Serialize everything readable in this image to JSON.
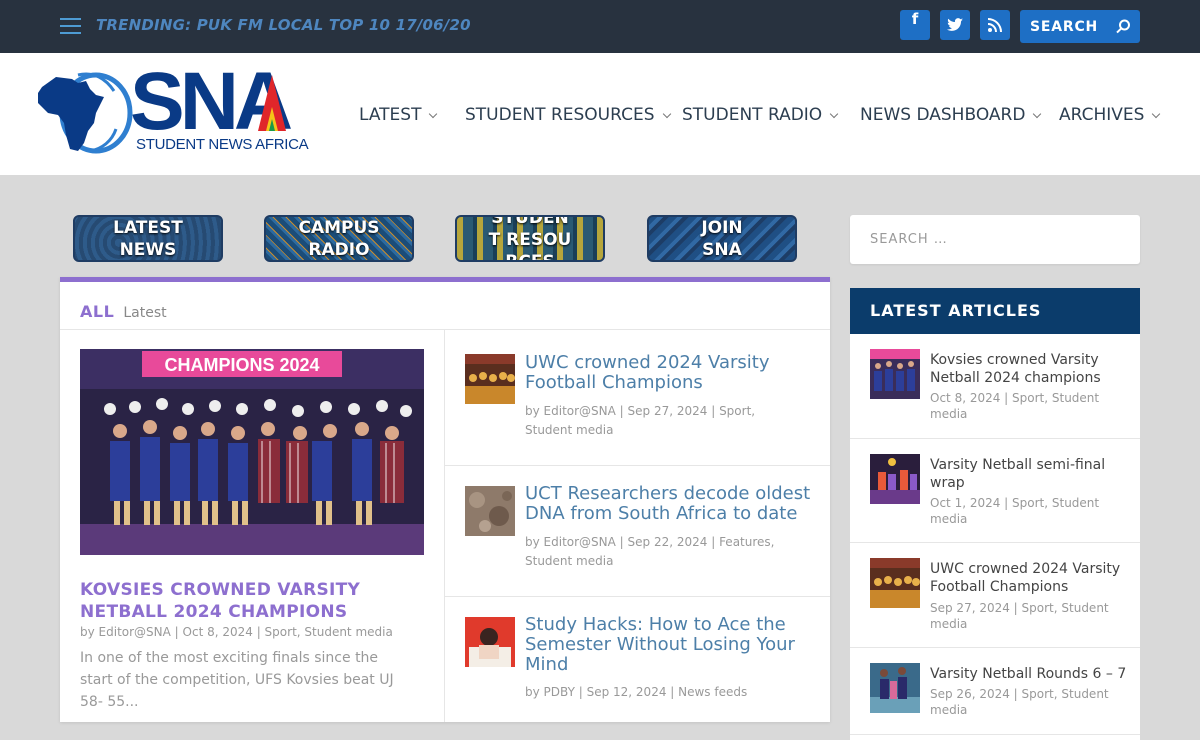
{
  "topbar": {
    "trending": "TRENDING: PUK FM LOCAL TOP 10 17/06/20",
    "social_icons": [
      "facebook-icon",
      "twitter-icon",
      "rss-icon"
    ],
    "search_label": "SEARCH"
  },
  "logo": {
    "sna": "SNA",
    "subtitle": "STUDENT NEWS AFRICA"
  },
  "nav": [
    "LATEST",
    "STUDENT RESOURCES",
    "STUDENT RADIO",
    "NEWS DASHBOARD",
    "ARCHIVES"
  ],
  "banners": [
    "LATEST NEWS",
    "CAMPUS RADIO",
    "STUDENT RESOURCES",
    "JOIN SNA"
  ],
  "panel": {
    "tab_all": "ALL",
    "tab_latest": "Latest",
    "featured": {
      "image_text": "CHAMPIONS 2024",
      "title": "KOVSIES CROWNED VARSITY NETBALL 2024 CHAMPIONS",
      "meta": "by Editor@SNA | Oct 8, 2024 | Sport, Student media",
      "excerpt": "In one of the most exciting finals since the start of the competition, UFS Kovsies beat UJ 58- 55..."
    },
    "items": [
      {
        "title": "UWC crowned 2024 Varsity Football Champions",
        "meta": "by Editor@SNA | Sep 27, 2024 | Sport, Student media"
      },
      {
        "title": "UCT Researchers decode oldest DNA from South Africa to date",
        "meta": "by Editor@SNA | Sep 22, 2024 | Features, Student media"
      },
      {
        "title": "Study Hacks: How to Ace the Semester Without Losing Your Mind",
        "meta": "by PDBY | Sep 12, 2024 | News feeds"
      }
    ]
  },
  "sidebar": {
    "search_placeholder": "SEARCH …",
    "heading": "LATEST ARTICLES",
    "articles": [
      {
        "title": "Kovsies crowned Varsity Netball 2024 champions",
        "meta": "Oct 8, 2024 | Sport, Student media"
      },
      {
        "title": "Varsity Netball semi-final wrap",
        "meta": "Oct 1, 2024 | Sport, Student media"
      },
      {
        "title": "UWC crowned 2024 Varsity Football Champions",
        "meta": "Sep 27, 2024 | Sport, Student media"
      },
      {
        "title": "Varsity Netball Rounds 6 – 7",
        "meta": "Sep 26, 2024 | Sport, Student media"
      }
    ]
  }
}
